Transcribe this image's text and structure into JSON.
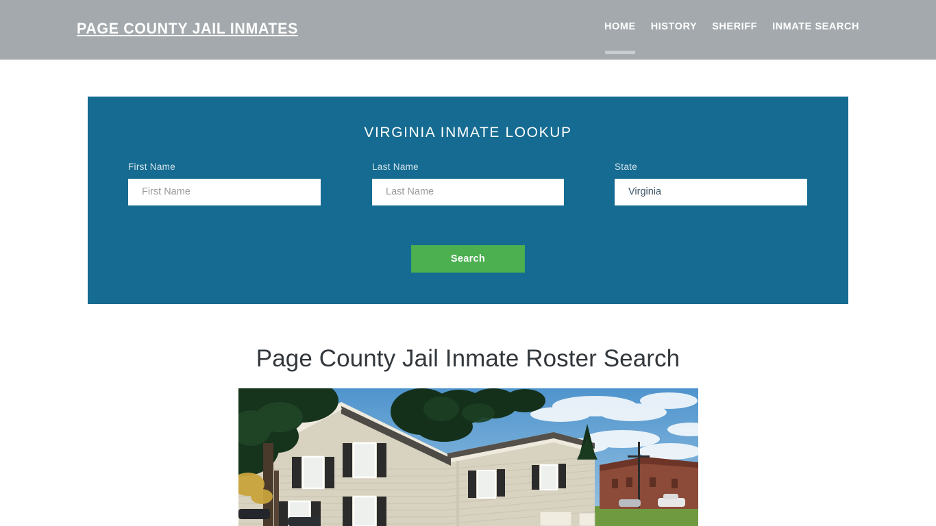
{
  "header": {
    "brand": "Page County Jail Inmates",
    "brand_color": "#ffffff",
    "background_color": "#a3a9ac",
    "nav": [
      {
        "label": "Home",
        "active": true
      },
      {
        "label": "History",
        "active": false
      },
      {
        "label": "Sheriff",
        "active": false
      },
      {
        "label": "Inmate Search",
        "active": false
      }
    ]
  },
  "search_panel": {
    "title": "Virginia Inmate Lookup",
    "background_color": "#156b91",
    "fields": {
      "first_name": {
        "label": "First Name",
        "placeholder": "First Name",
        "value": ""
      },
      "last_name": {
        "label": "Last Name",
        "placeholder": "Last Name",
        "value": ""
      },
      "state": {
        "label": "State",
        "placeholder": "State",
        "value": "Virginia"
      }
    },
    "submit": {
      "label": "Search",
      "color": "#4caf50"
    }
  },
  "main": {
    "page_title": "Page County Jail Inmate Roster Search",
    "photo": {
      "alt": "Page County Jail building exterior with beige vinyl siding, black shutters, trees and blue cloudy sky",
      "sky_color": "#6ba8d8",
      "siding_color": "#d8d2c0",
      "shutter_color": "#2b2b2b",
      "roof_color": "#5a5a58",
      "tree_color": "#16331c",
      "grass_color": "#6f9a3f",
      "brick_color": "#8c4a38"
    }
  }
}
